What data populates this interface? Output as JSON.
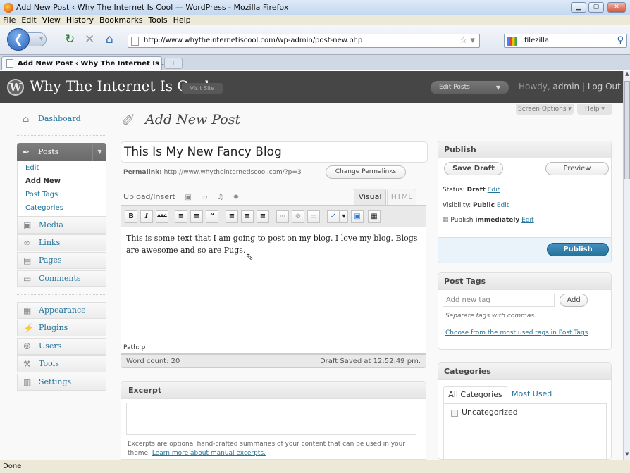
{
  "browser": {
    "window_title": "Add New Post ‹ Why The Internet Is Cool — WordPress - Mozilla Firefox",
    "menu": [
      "File",
      "Edit",
      "View",
      "History",
      "Bookmarks",
      "Tools",
      "Help"
    ],
    "url": "http://www.whytheinternetiscool.com/wp-admin/post-new.php",
    "search_value": "filezilla",
    "tab_title": "Add New Post ‹ Why The Internet Is ...",
    "new_tab_label": "+",
    "status": "Done"
  },
  "wp_header": {
    "site_name": "Why The Internet Is Cool",
    "visit_site": "Visit Site",
    "favorite_action": "Edit Posts",
    "howdy": "Howdy,",
    "user": "admin",
    "separator": "|",
    "logout": "Log Out",
    "screen_options": "Screen Options",
    "help": "Help"
  },
  "sidebar": {
    "dashboard": "Dashboard",
    "posts": "Posts",
    "posts_submenu": [
      "Edit",
      "Add New",
      "Post Tags",
      "Categories"
    ],
    "media": "Media",
    "links": "Links",
    "pages": "Pages",
    "comments": "Comments",
    "appearance": "Appearance",
    "plugins": "Plugins",
    "users": "Users",
    "tools": "Tools",
    "settings": "Settings"
  },
  "editor": {
    "page_title": "Add New Post",
    "post_title": "This Is My New Fancy Blog",
    "permalink_label": "Permalink:",
    "permalink_url": "http://www.whytheinternetiscool.com/?p=3",
    "change_permalinks": "Change Permalinks",
    "upload_insert": "Upload/Insert",
    "tab_visual": "Visual",
    "tab_html": "HTML",
    "toolbar": [
      "B",
      "I",
      "ABC",
      "≡",
      "≡",
      "“",
      "≡",
      "≡",
      "≡",
      "∞",
      "⊘",
      "▭",
      "✓",
      "▾",
      "▣",
      "▦"
    ],
    "body_text": "This is some text that I am going to post on my blog.  I love my blog.  Blogs are awesome and so are Pugs.",
    "path": "Path: p",
    "word_count": "Word count: 20",
    "draft_saved": "Draft Saved at 12:52:49 pm."
  },
  "excerpt": {
    "heading": "Excerpt",
    "note": "Excerpts are optional hand-crafted summaries of your content that can be used in your theme.",
    "learn_more": "Learn more about manual excerpts."
  },
  "publish": {
    "heading": "Publish",
    "save_draft": "Save Draft",
    "preview": "Preview",
    "status_label": "Status:",
    "status_value": "Draft",
    "visibility_label": "Visibility:",
    "visibility_value": "Public",
    "publish_label": "Publish",
    "publish_when": "immediately",
    "edit": "Edit",
    "publish_button": "Publish"
  },
  "post_tags": {
    "heading": "Post Tags",
    "placeholder": "Add new tag",
    "add": "Add",
    "hint": "Separate tags with commas.",
    "choose": "Choose from the most used tags in Post Tags"
  },
  "categories": {
    "heading": "Categories",
    "tab_all": "All Categories",
    "tab_most": "Most Used",
    "items": [
      "Uncategorized"
    ]
  },
  "colors": {
    "wp_header": "#464646",
    "link": "#21759b",
    "publish_button": "#21759b"
  }
}
